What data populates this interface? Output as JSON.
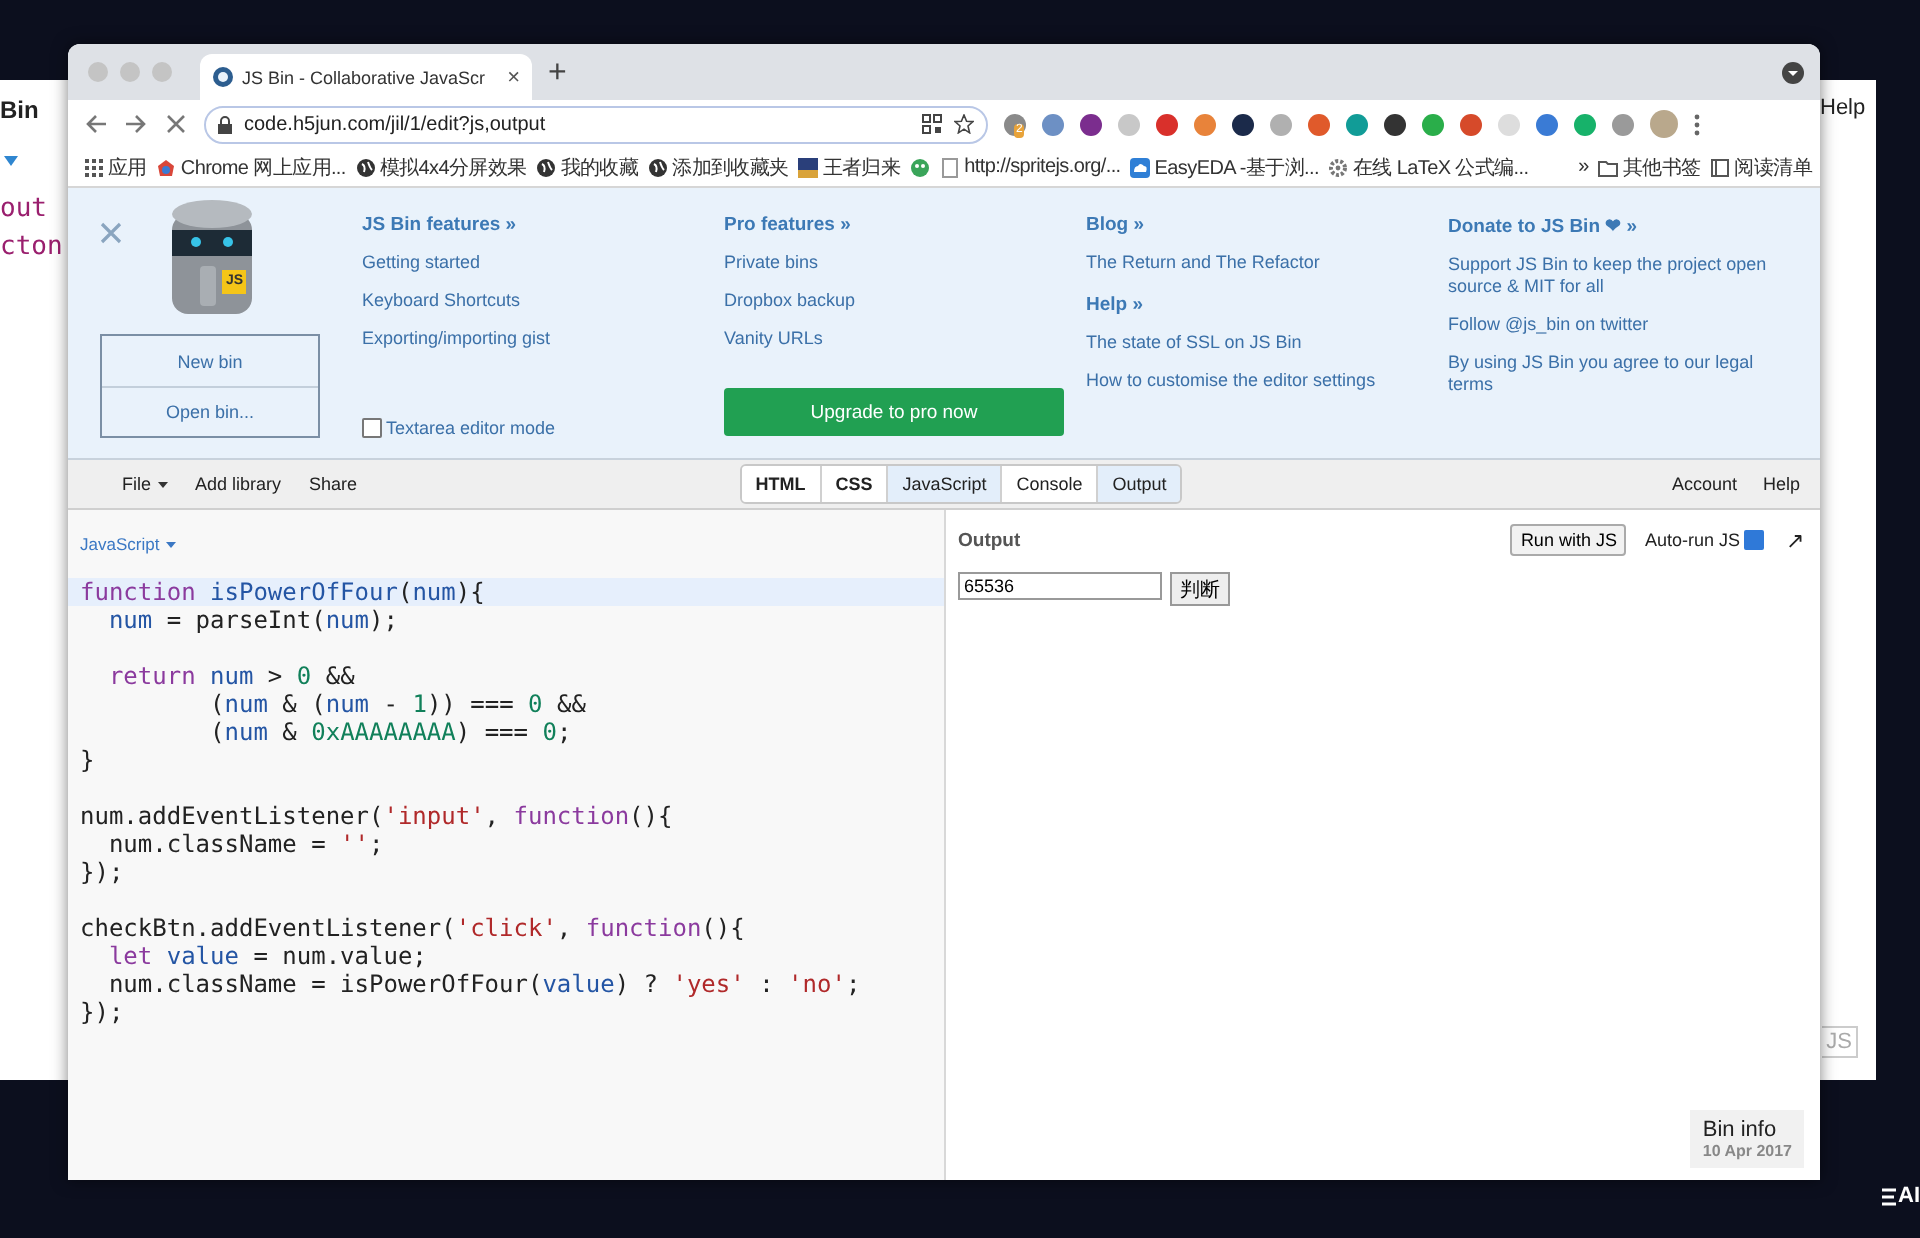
{
  "backdrop": {
    "back_window": {
      "title": "Bin",
      "code_lines": [
        "out",
        "cton"
      ],
      "menu": "Help",
      "button": "JS"
    },
    "corner_mark": "AI"
  },
  "browser": {
    "tab": {
      "title": "JS Bin - Collaborative JavaScr",
      "close": "×"
    },
    "new_tab": "+",
    "url": "code.h5jun.com/jil/1/edit?js,output",
    "extension_badge": "2",
    "bookmarks": [
      {
        "kind": "apps",
        "label": "应用"
      },
      {
        "kind": "store",
        "label": "Chrome 网上应用..."
      },
      {
        "kind": "site",
        "label": "模拟4x4分屏效果"
      },
      {
        "kind": "site",
        "label": "我的收藏"
      },
      {
        "kind": "site",
        "label": "添加到收藏夹"
      },
      {
        "kind": "image",
        "label": "王者归来"
      },
      {
        "kind": "icon"
      },
      {
        "kind": "blank",
        "label": "http://spritejs.org/..."
      },
      {
        "kind": "cloud",
        "label": "EasyEDA -基于浏..."
      },
      {
        "kind": "gear",
        "label": "在线 LaTeX 公式编..."
      }
    ],
    "overflow": "»",
    "folders": [
      {
        "kind": "folder",
        "label": "其他书签"
      },
      {
        "kind": "reading",
        "label": "阅读清单"
      }
    ]
  },
  "jsbin": {
    "panel": {
      "logo_badge": "JS",
      "bin_buttons": [
        "New bin",
        "Open bin..."
      ],
      "columns": [
        {
          "sections": [
            {
              "heading": "JS Bin features »",
              "links": [
                "Getting started",
                "Keyboard Shortcuts",
                "Exporting/importing gist"
              ]
            }
          ],
          "checkbox": {
            "label": "Textarea editor mode",
            "checked": false
          }
        },
        {
          "sections": [
            {
              "heading": "Pro features »",
              "links": [
                "Private bins",
                "Dropbox backup",
                "Vanity URLs"
              ]
            }
          ],
          "button": "Upgrade to pro now"
        },
        {
          "sections": [
            {
              "heading": "Blog »",
              "links": [
                "The Return and The Refactor"
              ]
            },
            {
              "heading": "Help »",
              "links": [
                "The state of SSL on JS Bin",
                "How to customise the editor settings"
              ]
            }
          ]
        },
        {
          "sections": [
            {
              "heading": "Donate to JS Bin ❤ »",
              "links": [
                "Support JS Bin to keep the project open source & MIT for all",
                "Follow @js_bin on twitter",
                "By using JS Bin you agree to our legal terms"
              ]
            }
          ]
        }
      ]
    },
    "toolbar": {
      "menu": [
        {
          "label": "File",
          "dropdown": true
        },
        {
          "label": "Add library",
          "dropdown": false
        },
        {
          "label": "Share",
          "dropdown": false
        }
      ],
      "panels": [
        {
          "label": "HTML",
          "selected": false,
          "has_content": true
        },
        {
          "label": "CSS",
          "selected": false,
          "has_content": true
        },
        {
          "label": "JavaScript",
          "selected": true,
          "has_content": false
        },
        {
          "label": "Console",
          "selected": false,
          "has_content": false
        },
        {
          "label": "Output",
          "selected": true,
          "has_content": false
        }
      ],
      "right_links": [
        "Account",
        "Help"
      ]
    },
    "editor": {
      "language": "JavaScript",
      "lines": [
        {
          "kind": "code",
          "active": true,
          "tokens": [
            {
              "kind": "kw",
              "text": "function"
            },
            {
              "kind": "def",
              "text": " isPowerOfFour"
            },
            {
              "kind": "plain",
              "text": "("
            },
            {
              "kind": "def",
              "text": "num"
            },
            {
              "kind": "plain",
              "text": "){"
            }
          ]
        },
        {
          "kind": "code",
          "active": false,
          "tokens": [
            {
              "kind": "def",
              "text": "  num"
            },
            {
              "kind": "plain",
              "text": " = parseInt("
            },
            {
              "kind": "def",
              "text": "num"
            },
            {
              "kind": "plain",
              "text": ");"
            }
          ]
        },
        {
          "kind": "blank"
        },
        {
          "kind": "code",
          "active": false,
          "tokens": [
            {
              "kind": "kw",
              "text": "  return"
            },
            {
              "kind": "def",
              "text": " num"
            },
            {
              "kind": "plain",
              "text": " > "
            },
            {
              "kind": "num",
              "text": "0"
            },
            {
              "kind": "plain",
              "text": " &&"
            }
          ]
        },
        {
          "kind": "code",
          "active": false,
          "tokens": [
            {
              "kind": "plain",
              "text": "         ("
            },
            {
              "kind": "def",
              "text": "num"
            },
            {
              "kind": "plain",
              "text": " & ("
            },
            {
              "kind": "def",
              "text": "num"
            },
            {
              "kind": "plain",
              "text": " - "
            },
            {
              "kind": "num",
              "text": "1"
            },
            {
              "kind": "plain",
              "text": ")) === "
            },
            {
              "kind": "num",
              "text": "0"
            },
            {
              "kind": "plain",
              "text": " &&"
            }
          ]
        },
        {
          "kind": "code",
          "active": false,
          "tokens": [
            {
              "kind": "plain",
              "text": "         ("
            },
            {
              "kind": "def",
              "text": "num"
            },
            {
              "kind": "plain",
              "text": " & "
            },
            {
              "kind": "num",
              "text": "0xAAAAAAAA"
            },
            {
              "kind": "plain",
              "text": ") === "
            },
            {
              "kind": "num",
              "text": "0"
            },
            {
              "kind": "plain",
              "text": ";"
            }
          ]
        },
        {
          "kind": "code",
          "active": false,
          "tokens": [
            {
              "kind": "plain",
              "text": "}"
            }
          ]
        },
        {
          "kind": "blank"
        },
        {
          "kind": "code",
          "active": false,
          "tokens": [
            {
              "kind": "plain",
              "text": "num.addEventListener("
            },
            {
              "kind": "str",
              "text": "'input'"
            },
            {
              "kind": "plain",
              "text": ", "
            },
            {
              "kind": "kw",
              "text": "function"
            },
            {
              "kind": "plain",
              "text": "(){"
            }
          ]
        },
        {
          "kind": "code",
          "active": false,
          "tokens": [
            {
              "kind": "plain",
              "text": "  num.className = "
            },
            {
              "kind": "str",
              "text": "''"
            },
            {
              "kind": "plain",
              "text": ";"
            }
          ]
        },
        {
          "kind": "code",
          "active": false,
          "tokens": [
            {
              "kind": "plain",
              "text": "});"
            }
          ]
        },
        {
          "kind": "blank"
        },
        {
          "kind": "code",
          "active": false,
          "tokens": [
            {
              "kind": "plain",
              "text": "checkBtn.addEventListener("
            },
            {
              "kind": "str",
              "text": "'click'"
            },
            {
              "kind": "plain",
              "text": ", "
            },
            {
              "kind": "kw",
              "text": "function"
            },
            {
              "kind": "plain",
              "text": "(){"
            }
          ]
        },
        {
          "kind": "code",
          "active": false,
          "tokens": [
            {
              "kind": "kw",
              "text": "  let"
            },
            {
              "kind": "def",
              "text": " value"
            },
            {
              "kind": "plain",
              "text": " = num.value;"
            }
          ]
        },
        {
          "kind": "code",
          "active": false,
          "tokens": [
            {
              "kind": "plain",
              "text": "  num.className = isPowerOfFour("
            },
            {
              "kind": "def",
              "text": "value"
            },
            {
              "kind": "plain",
              "text": ") ? "
            },
            {
              "kind": "str",
              "text": "'yes'"
            },
            {
              "kind": "plain",
              "text": " : "
            },
            {
              "kind": "str",
              "text": "'no'"
            },
            {
              "kind": "plain",
              "text": ";"
            }
          ]
        },
        {
          "kind": "code",
          "active": false,
          "tokens": [
            {
              "kind": "plain",
              "text": "});"
            }
          ]
        }
      ]
    },
    "output": {
      "title": "Output",
      "run_button": "Run with JS",
      "auto_run": {
        "label": "Auto-run JS",
        "checked": true
      },
      "popout": "↗",
      "demo": {
        "value": "65536",
        "button": "判断"
      },
      "bin_info": {
        "title": "Bin info",
        "date": "10 Apr 2017"
      }
    }
  }
}
